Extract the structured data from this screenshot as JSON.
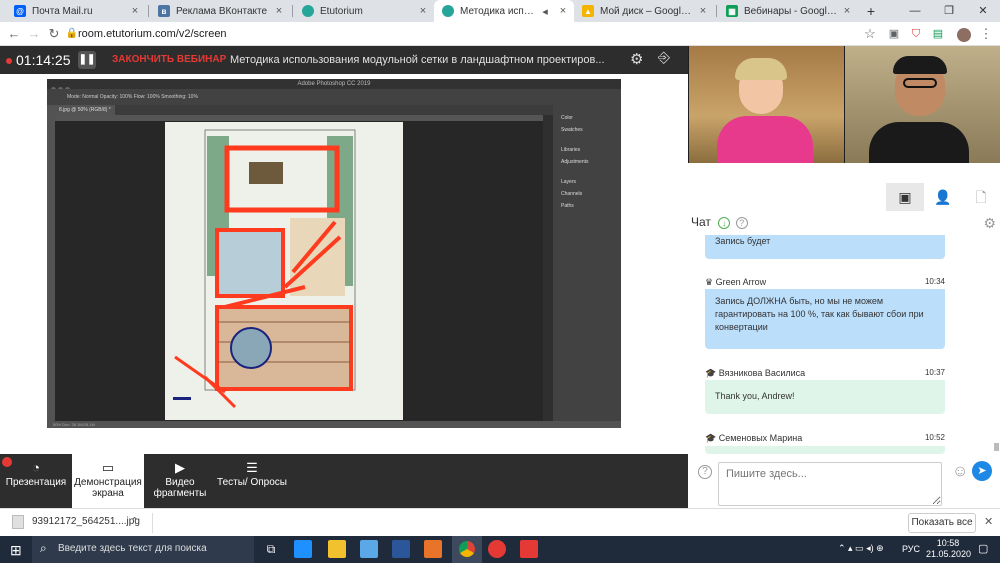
{
  "browser": {
    "tabs": [
      {
        "title": "Почта Mail.ru",
        "close": "×",
        "icon": "mail-ru-icon",
        "color": "#005ff9"
      },
      {
        "title": "Реклама ВКонтакте",
        "close": "×",
        "icon": "vk-icon",
        "color": "#4c75a3"
      },
      {
        "title": "Etutorium",
        "close": "×",
        "icon": "etutorium-icon",
        "color": "#26a69a"
      },
      {
        "title": "Методика использован",
        "close": "×",
        "icon": "etutorium-icon",
        "color": "#26a69a"
      },
      {
        "title": "Мой диск – Google Диск",
        "close": "×",
        "icon": "google-drive-icon",
        "color": "#f4b400"
      },
      {
        "title": "Вебинары - Google Таблиц",
        "close": "×",
        "icon": "google-sheets-icon",
        "color": "#0f9d58"
      }
    ],
    "new_tab": "+",
    "url": "room.etutorium.com/v2/screen"
  },
  "app": {
    "timer": "01:14:25",
    "finish_label": "ЗАКОНЧИТЬ ВЕБИНАР",
    "webinar_title": "Методика использования модульной сетки в ландшафтном проектиров..."
  },
  "photoshop": {
    "title": "Adobe Photoshop CC 2019",
    "options": "Mode: Normal   Opacity: 100%   Flow: 100%   Smoothing: 10%",
    "doc_tab": "8.jpg @ 50% (RGB/8) *",
    "status": "50%   Doc: 28.1M/28.1M",
    "panels": [
      "Color",
      "Swatches",
      "Libraries",
      "Adjustments",
      "Layers",
      "Channels",
      "Paths"
    ]
  },
  "toolbar": {
    "buttons": [
      {
        "label": "Презентация"
      },
      {
        "label": "Демонстрация экрана"
      },
      {
        "label": "Видео фрагменты"
      },
      {
        "label": "Тесты/ Опросы"
      }
    ]
  },
  "chat": {
    "title": "Чат",
    "messages": [
      {
        "sender": "",
        "time": "",
        "text": "Запись будет",
        "color": "#bbdefb"
      },
      {
        "sender": "Green Arrow",
        "time": "10:34",
        "text": "Запись ДОЛЖНА быть, но мы не можем гарантировать на 100 %, так как бывают сбои при конвертации",
        "color": "#bbdefb"
      },
      {
        "sender": "Вязникова Василиса",
        "time": "10:37",
        "text": "Thank you, Andrew!",
        "color": "#e0f5e9"
      },
      {
        "sender": "Семеновых Марина",
        "time": "10:52",
        "text": "",
        "color": "#e0f5e9"
      }
    ],
    "input_placeholder": "Пишите здесь..."
  },
  "downloads": {
    "file": "93912172_564251....jpg",
    "show_all": "Показать все"
  },
  "taskbar": {
    "search_placeholder": "Введите здесь текст для поиска",
    "lang": "РУС",
    "time": "10:58",
    "date": "21.05.2020"
  }
}
